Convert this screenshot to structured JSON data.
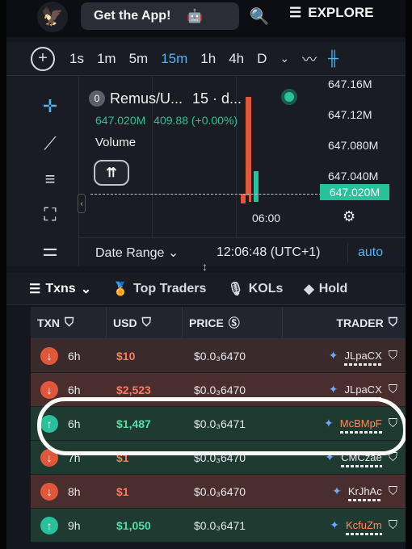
{
  "topbar": {
    "get_app_label": "Get the App!",
    "explore_label": "EXPLORE"
  },
  "timeframes": {
    "items": [
      "1s",
      "1m",
      "5m",
      "15m",
      "1h",
      "4h",
      "D"
    ],
    "active": "15m"
  },
  "chart": {
    "legend_index": "0",
    "pair_title": "Remus/U...",
    "interval": "15 · d...",
    "price": "647.020M",
    "change": "409.88 (+0.00%)",
    "volume_label": "Volume",
    "price_ticks": [
      "647.16M",
      "647.12M",
      "647.080M",
      "647.040M"
    ],
    "current_price": "647.020M",
    "time_tick": "06:00",
    "date_range_label": "Date Range",
    "clock": "12:06:48 (UTC+1)",
    "auto_label": "auto"
  },
  "tabs": [
    "Txns",
    "Top Traders",
    "KOLs",
    "Hold"
  ],
  "table": {
    "headers": {
      "txn": "TXN",
      "usd": "USD",
      "price": "PRICE",
      "trader": "TRADER"
    },
    "rows": [
      {
        "side": "sell",
        "age": "6h",
        "usd": "$10",
        "price": "$0.0₃6470",
        "trader": "JLpaCX"
      },
      {
        "side": "sell",
        "age": "6h",
        "usd": "$2,523",
        "price": "$0.0₃6470",
        "trader": "JLpaCX"
      },
      {
        "side": "buy",
        "age": "6h",
        "usd": "$1,487",
        "price": "$0.0₃6471",
        "trader": "McBMpF"
      },
      {
        "side": "sell",
        "age": "7h",
        "usd": "$1",
        "price": "$0.0₃6470",
        "trader": "CMCzae"
      },
      {
        "side": "sell",
        "age": "8h",
        "usd": "$1",
        "price": "$0.0₃6470",
        "trader": "KrJhAc"
      },
      {
        "side": "buy",
        "age": "9h",
        "usd": "$1,050",
        "price": "$0.0₃6471",
        "trader": "KcfuZm"
      }
    ]
  },
  "colors": {
    "buy": "#27c29b",
    "sell": "#e0573c",
    "accent": "#4fb7f5"
  }
}
